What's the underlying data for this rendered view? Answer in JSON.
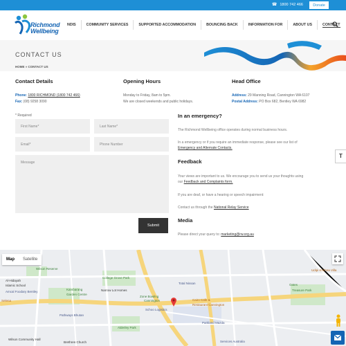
{
  "topbar": {
    "phone": "1800 742 466",
    "donate": "Donate"
  },
  "logo": {
    "line1": "Richmond",
    "line2": "Wellbeing"
  },
  "nav": [
    "NDIS",
    "COMMUNITY SERVICES",
    "SUPPORTED ACCOMMODATION",
    "BOUNCING BACK",
    "INFORMATION FOR",
    "ABOUT US",
    "CONTACT"
  ],
  "hero": {
    "title": "CONTACT US",
    "breadcrumb": "HOME » CONTACT US"
  },
  "contact": {
    "heading": "Contact Details",
    "phone_label": "Phone:",
    "phone_value": "1800 RICHMOND (1800 742 466)",
    "fax_label": "Fax:",
    "fax_value": "(08) 9258 3090"
  },
  "hours": {
    "heading": "Opening Hours",
    "line1": "Monday to Friday, 8am to 5pm.",
    "line2": "We are closed weekends and public holidays."
  },
  "office": {
    "heading": "Head Office",
    "address_label": "Address:",
    "address_value": "29 Manning Road, Cannington WA 6107",
    "postal_label": "Postal Address:",
    "postal_value": "PO Box 682, Bentley WA 6982"
  },
  "form": {
    "required_note": "* Required",
    "first_name": "First Name*",
    "last_name": "Last Name*",
    "email": "Email*",
    "phone": "Phone Number",
    "message": "Message",
    "submit": "Submit"
  },
  "emergency": {
    "heading": "In an emergency?",
    "p1": "The Richmond Wellbeing office operates during normal business hours.",
    "p2": "In a emergency or if you require an immediate response, please see our list of",
    "link": "Emergency and Alternate Contacts."
  },
  "feedback": {
    "heading": "Feedback",
    "p1": "Your views are important to us. We encourage you to send us your thoughts using",
    "p1_prefix": "our",
    "link": "Feedback and Complaints form.",
    "p2": "If you are deaf, or have a hearing or speech impairment:",
    "p3": "Contact us through the",
    "p3_link": "National Relay Service"
  },
  "media": {
    "heading": "Media",
    "text": "Please direct your query to:",
    "email": "marketing@rw.org.au"
  },
  "side_tab": "T",
  "map": {
    "type_map": "Map",
    "type_satellite": "Satellite",
    "labels": {
      "wilson_reserve": "Wilson Reserve",
      "al_hidayah": "Al-Hidayah",
      "islamic_school": "Islamic School",
      "amcal": "Amcal Foodary Bentley",
      "selena": "Selena",
      "kambarang": "Kambarang",
      "garden_centre": "Garden Centre",
      "college_grove": "College Grove Park",
      "narrow_lot": "Narrow Lot Homes",
      "zone_bowling": "Zone Bowling",
      "cannington": "Cannington",
      "total_nissan": "Total Nissan",
      "cairo_cafe": "Cairo Cafe &",
      "restaurant": "Restaurant Cannington",
      "pathways": "Pathways Bhutan",
      "schoo_logistics": "Schoo Logistics",
      "parkland": "Parkland Mazda",
      "alderley": "Alderley Park",
      "wilson_hall": "Wilson Community Hall",
      "brethren": "Brethren Church",
      "services_aus": "Services Australia",
      "udipi": "Udipi Krishna Villa",
      "treasure": "Treasure Park",
      "oats": "Oates"
    }
  }
}
